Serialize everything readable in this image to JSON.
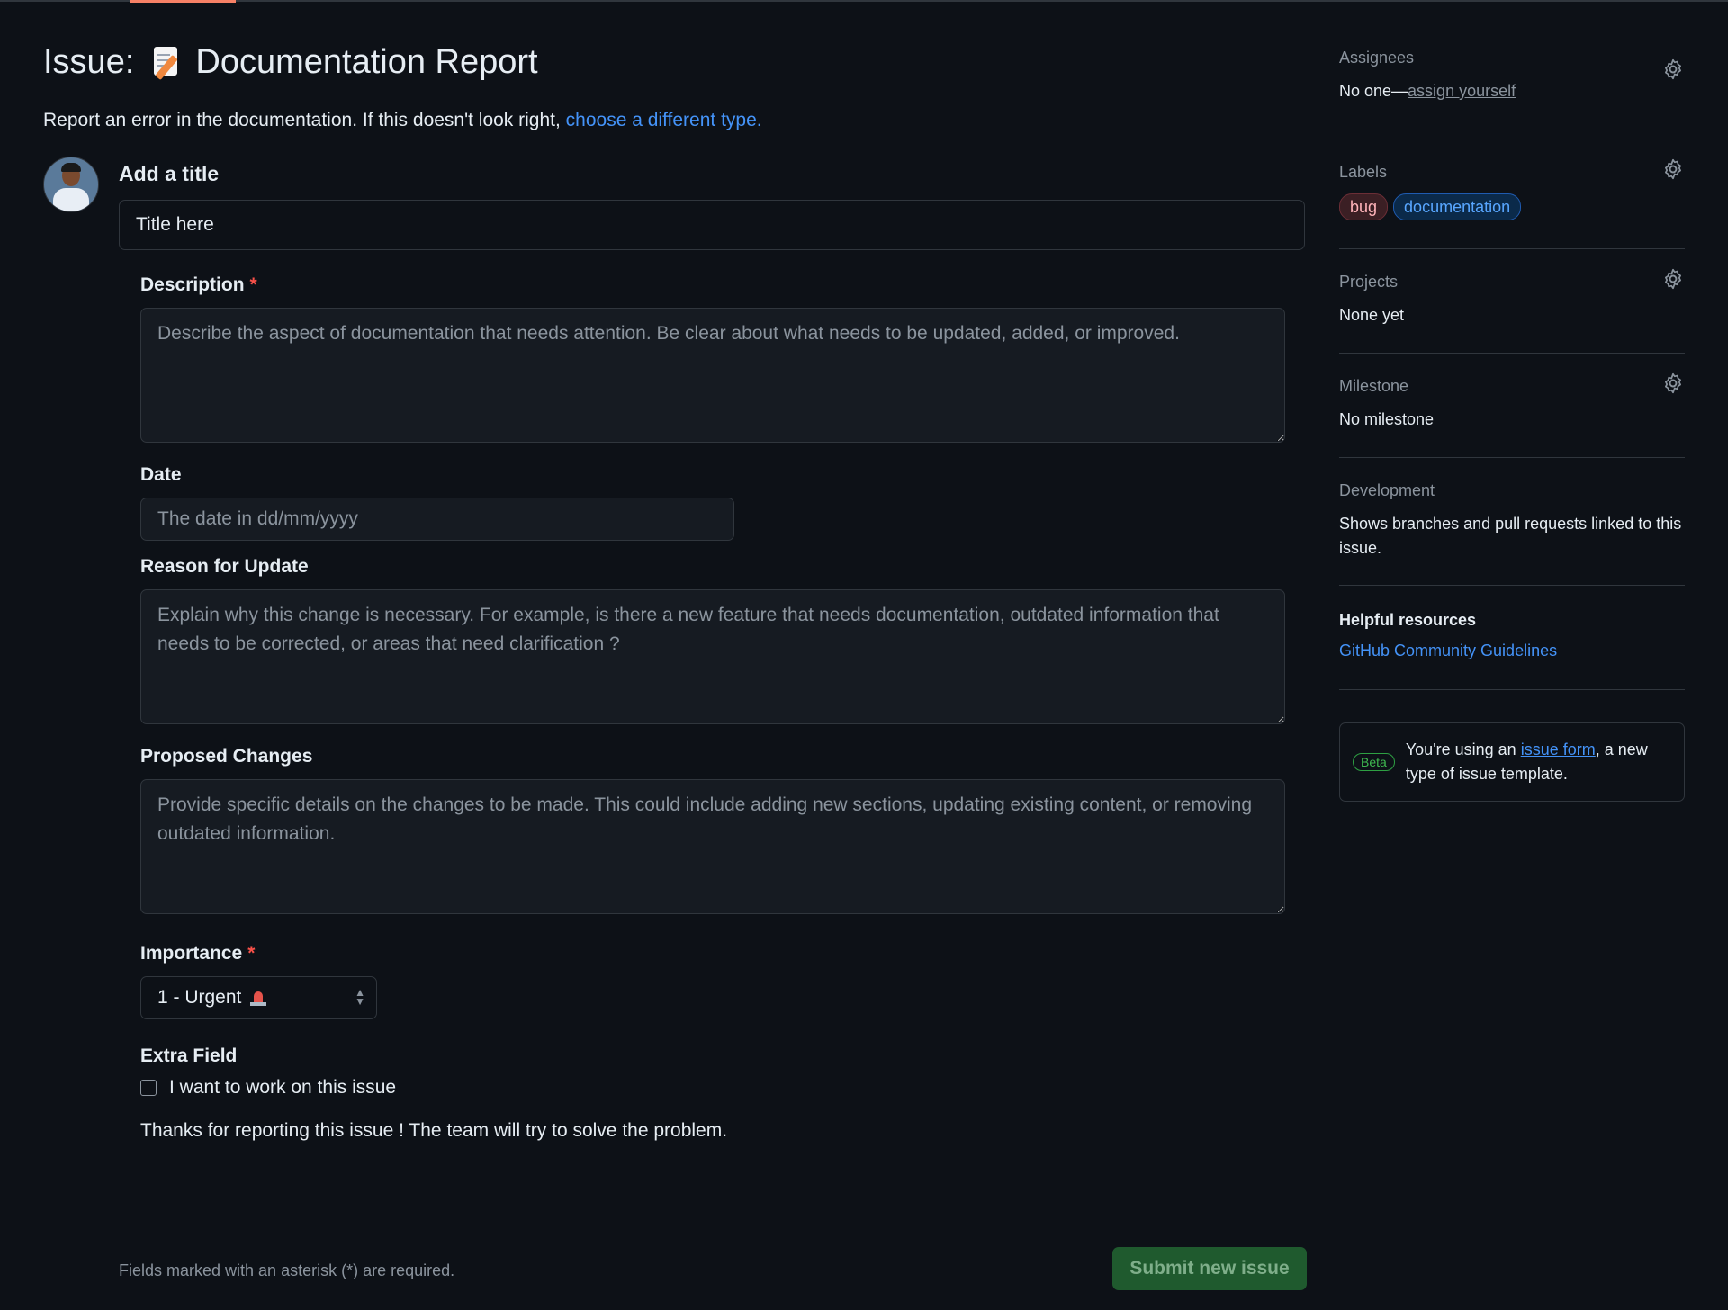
{
  "header": {
    "prefix": "Issue:",
    "title": "Documentation Report",
    "subtitle_text": "Report an error in the documentation. If this doesn't look right,",
    "subtitle_link": "choose a different type."
  },
  "title_field": {
    "label": "Add a title",
    "value": "Title here"
  },
  "form": {
    "description": {
      "label": "Description",
      "required_mark": "*",
      "placeholder": "Describe the aspect of documentation that needs attention. Be clear about what needs to be updated, added, or improved."
    },
    "date": {
      "label": "Date",
      "placeholder": "The date in dd/mm/yyyy"
    },
    "reason": {
      "label": "Reason for Update",
      "placeholder": "Explain why this change is necessary. For example, is there a new feature that needs documentation, outdated information that needs to be corrected, or areas that need clarification ?"
    },
    "proposed": {
      "label": "Proposed Changes",
      "placeholder": "Provide specific details on the changes to be made. This could include adding new sections, updating existing content, or removing outdated information."
    },
    "importance": {
      "label": "Importance",
      "required_mark": "*",
      "selected": "1 - Urgent"
    },
    "extra": {
      "label": "Extra Field",
      "checkbox_label": "I want to work on this issue",
      "checked": false
    },
    "thanks": "Thanks for reporting this issue ! The team will try to solve the problem."
  },
  "footer": {
    "note": "Fields marked with an asterisk (*) are required.",
    "submit_label": "Submit new issue"
  },
  "sidebar": {
    "assignees": {
      "heading": "Assignees",
      "value": "No one—",
      "link": "assign yourself"
    },
    "labels": {
      "heading": "Labels",
      "items": [
        "bug",
        "documentation"
      ]
    },
    "projects": {
      "heading": "Projects",
      "value": "None yet"
    },
    "milestone": {
      "heading": "Milestone",
      "value": "No milestone"
    },
    "development": {
      "heading": "Development",
      "value": "Shows branches and pull requests linked to this issue."
    },
    "helpful": {
      "heading": "Helpful resources",
      "link": "GitHub Community Guidelines"
    },
    "beta": {
      "badge": "Beta",
      "text_before": "You're using an",
      "link": "issue form",
      "text_after": ", a new type of issue template."
    }
  },
  "colors": {
    "background": "#0d1117",
    "link": "#4493f8",
    "required": "#f85149",
    "submit_bg": "#1f5a2e"
  }
}
